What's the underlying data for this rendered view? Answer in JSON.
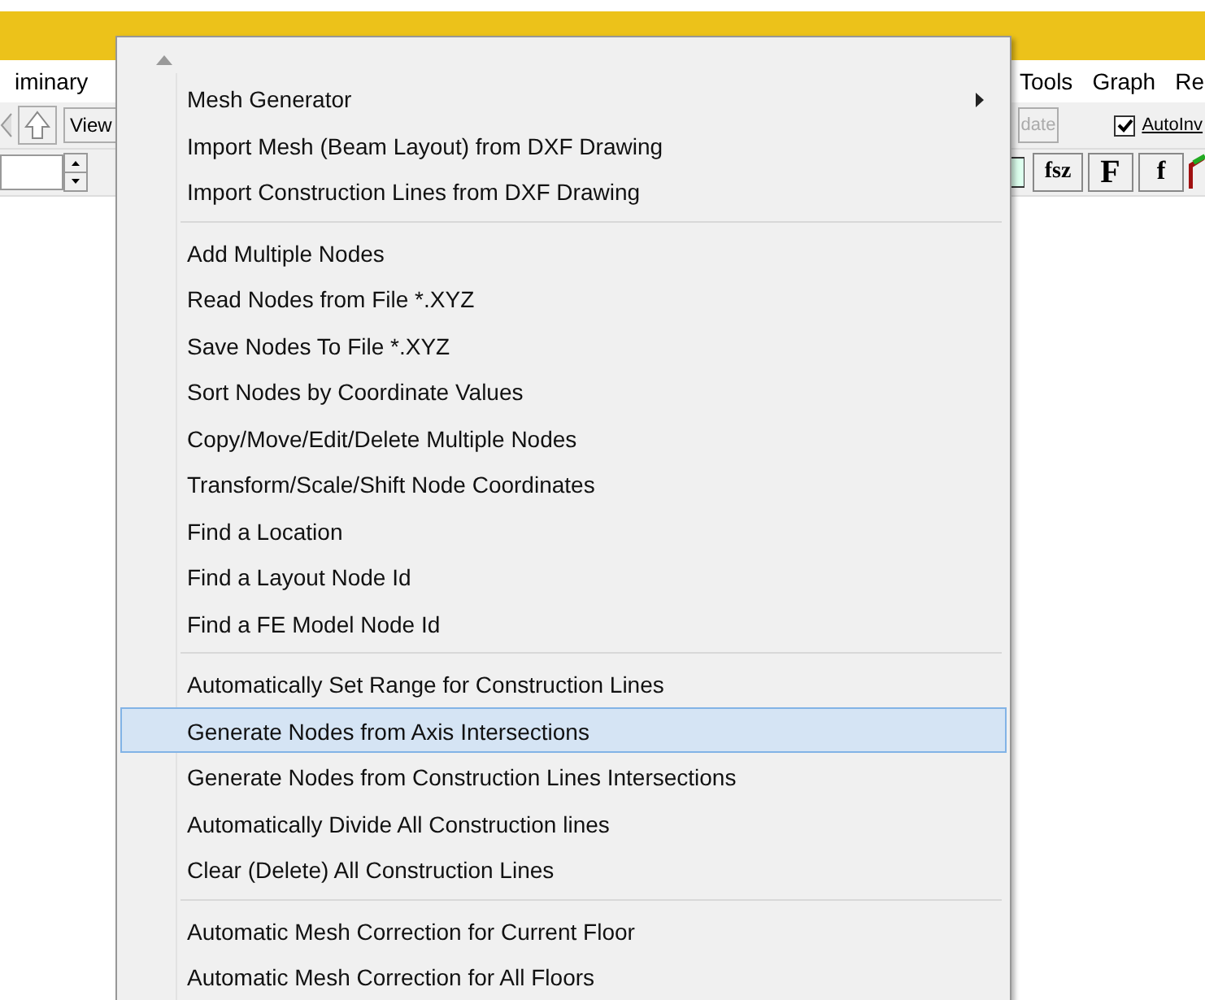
{
  "menubar": {
    "left_items": [
      "iminary"
    ],
    "right_items": [
      "Tools",
      "Graph",
      "Re"
    ]
  },
  "toolbar_row_1": {
    "view_button": "View",
    "update_button": {
      "label": "date",
      "disabled": true
    },
    "auto_checkbox": {
      "label": "AutoInv",
      "checked": true
    }
  },
  "toolbar_row_2": {
    "font_buttons": [
      "fsz",
      "F",
      "f"
    ]
  },
  "menu": {
    "items": [
      {
        "kind": "item",
        "label": "Mesh Generator",
        "submenu": true,
        "selected": false
      },
      {
        "kind": "item",
        "label": "Import Mesh (Beam Layout) from DXF Drawing",
        "submenu": false,
        "selected": false
      },
      {
        "kind": "item",
        "label": "Import Construction Lines from DXF Drawing",
        "submenu": false,
        "selected": false
      },
      {
        "kind": "separator"
      },
      {
        "kind": "item",
        "label": "Add Multiple Nodes",
        "submenu": false,
        "selected": false
      },
      {
        "kind": "item",
        "label": "Read Nodes from File *.XYZ",
        "submenu": false,
        "selected": false
      },
      {
        "kind": "item",
        "label": "Save Nodes To File *.XYZ",
        "submenu": false,
        "selected": false
      },
      {
        "kind": "item",
        "label": "Sort Nodes by Coordinate Values",
        "submenu": false,
        "selected": false
      },
      {
        "kind": "item",
        "label": "Copy/Move/Edit/Delete Multiple Nodes",
        "submenu": false,
        "selected": false
      },
      {
        "kind": "item",
        "label": "Transform/Scale/Shift Node Coordinates",
        "submenu": false,
        "selected": false
      },
      {
        "kind": "item",
        "label": "Find a Location",
        "submenu": false,
        "selected": false
      },
      {
        "kind": "item",
        "label": "Find a Layout Node Id",
        "submenu": false,
        "selected": false
      },
      {
        "kind": "item",
        "label": "Find a FE Model Node Id",
        "submenu": false,
        "selected": false
      },
      {
        "kind": "separator"
      },
      {
        "kind": "item",
        "label": "Automatically Set Range for Construction Lines",
        "submenu": false,
        "selected": false
      },
      {
        "kind": "item",
        "label": "Generate Nodes from Axis Intersections",
        "submenu": false,
        "selected": true
      },
      {
        "kind": "item",
        "label": "Generate Nodes from Construction Lines Intersections",
        "submenu": false,
        "selected": false
      },
      {
        "kind": "item",
        "label": "Automatically Divide All Construction lines",
        "submenu": false,
        "selected": false
      },
      {
        "kind": "item",
        "label": "Clear (Delete) All Construction Lines",
        "submenu": false,
        "selected": false
      },
      {
        "kind": "separator"
      },
      {
        "kind": "item",
        "label": "Automatic Mesh Correction for Current Floor",
        "submenu": false,
        "selected": false
      },
      {
        "kind": "item",
        "label": "Automatic Mesh Correction for All Floors",
        "submenu": false,
        "selected": false
      }
    ]
  }
}
